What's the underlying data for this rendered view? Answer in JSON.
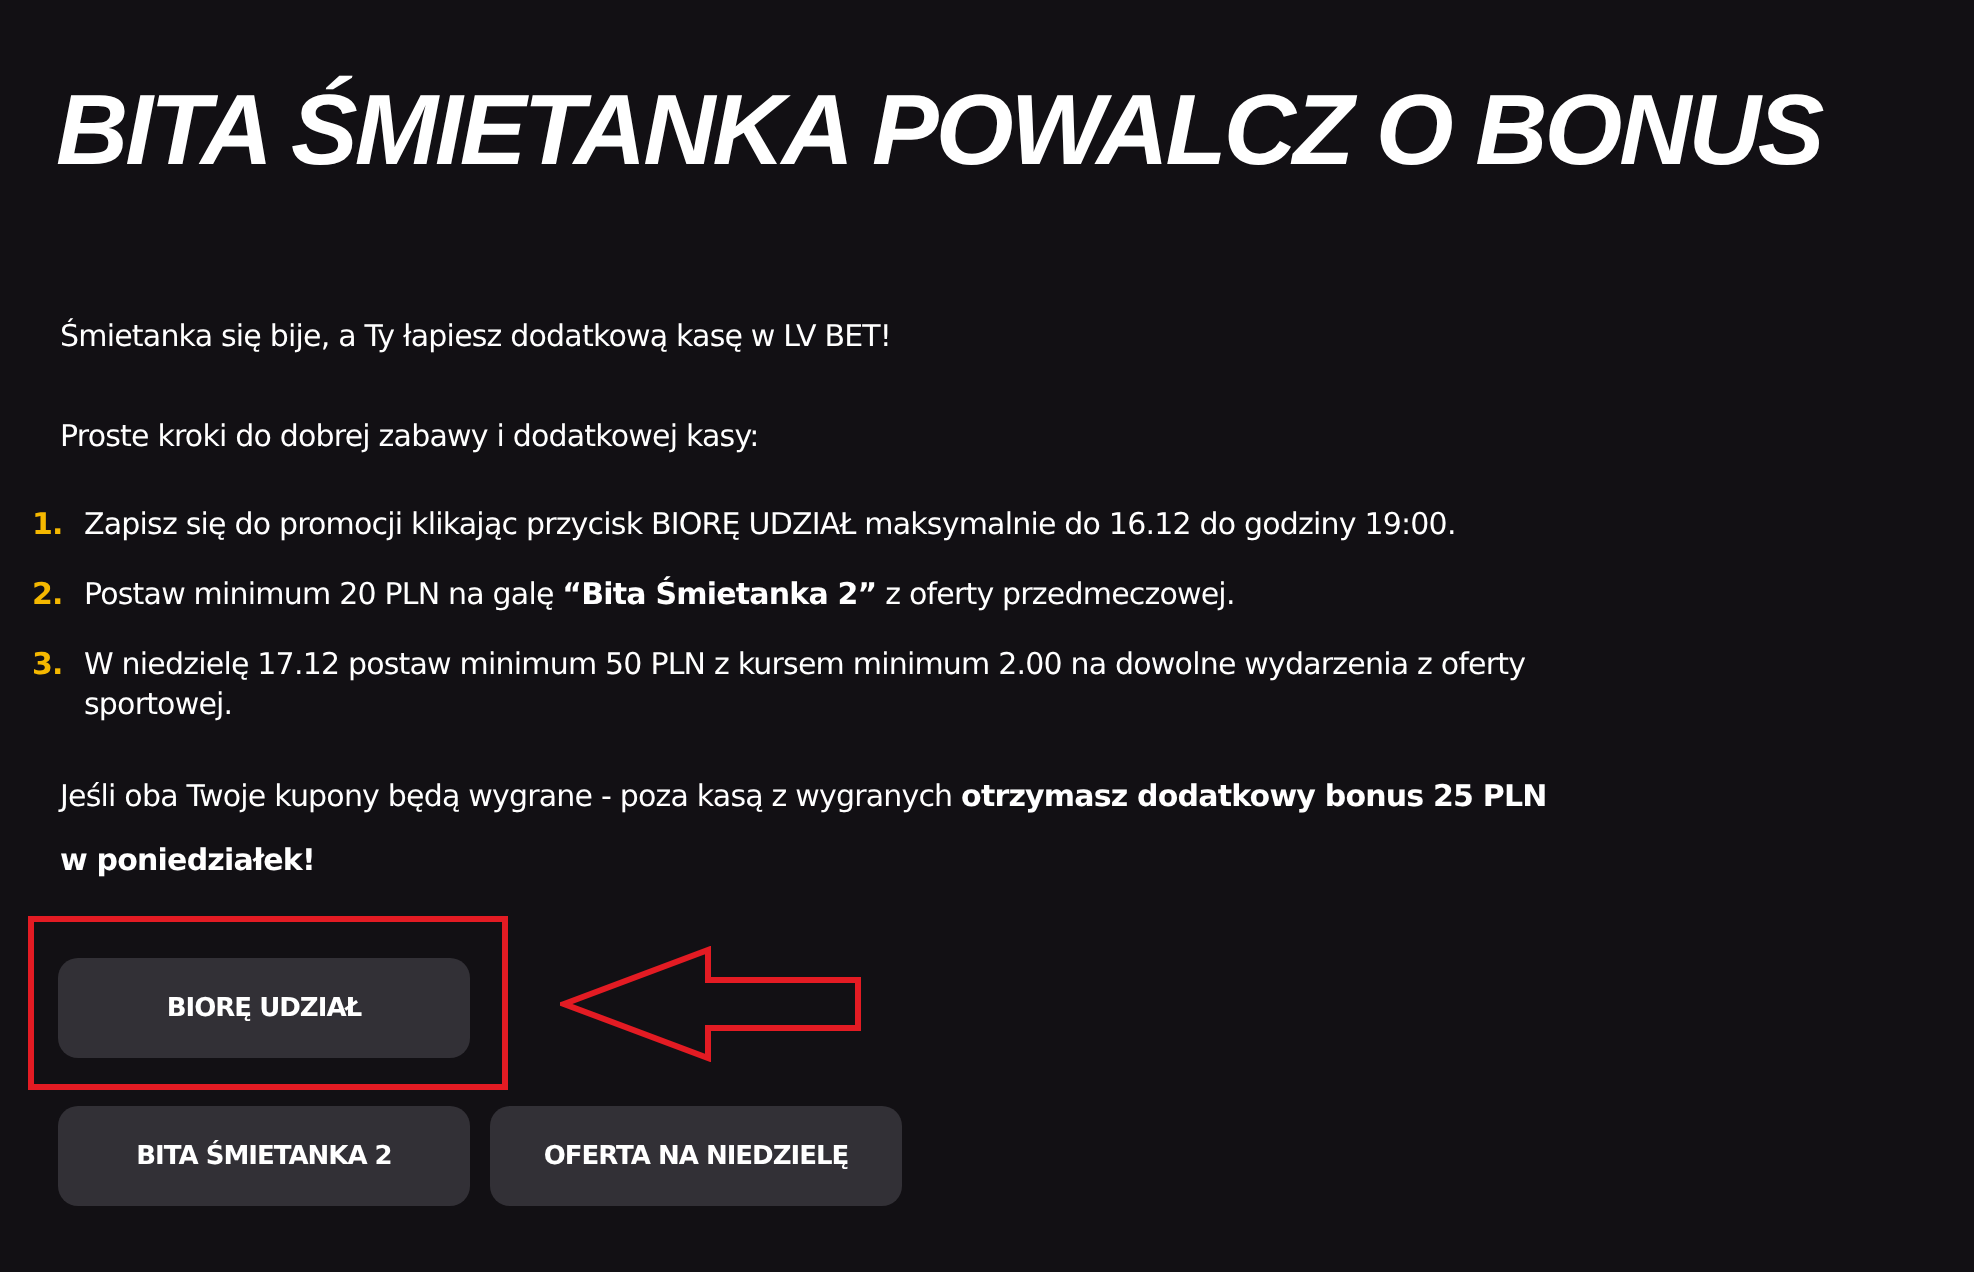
{
  "title": "BITA ŚMIETANKA POWALCZ O BONUS",
  "intro": "Śmietanka się bije, a Ty łapiesz dodatkową kasę w LV BET!",
  "steps_heading": "Proste kroki do dobrej zabawy i dodatkowej kasy:",
  "steps": [
    {
      "number": "1.",
      "text": "Zapisz się do promocji klikając przycisk BIORĘ UDZIAŁ maksymalnie do 16.12 do godziny 19:00."
    },
    {
      "number": "2.",
      "text": "Postaw minimum 20 PLN na galę **“Bita Śmietanka 2”** z oferty przedmeczowej."
    },
    {
      "number": "3.",
      "text": "W niedzielę 17.12 postaw minimum 50 PLN z kursem minimum 2.00 na dowolne wydarzenia z oferty sportowej."
    }
  ],
  "summary": "Jeśli oba Twoje kupony będą wygrane - poza kasą z wygranych **otrzymasz dodatkowy bonus 25 PLN w poniedziałek!**",
  "main_button": {
    "label": "BIORĘ UDZIAŁ",
    "highlighted": true
  },
  "buttons": [
    "BITA ŚMIETANKA 2",
    "OFERTA NA NIEDZIELĘ"
  ]
}
